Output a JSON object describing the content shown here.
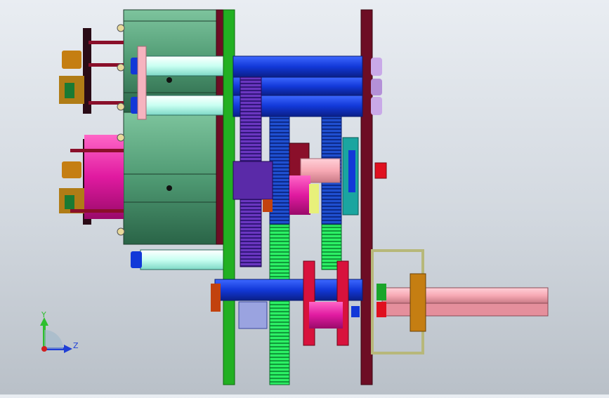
{
  "viewport": {
    "kind": "3D CAD assembly view (gearbox, side projection)"
  },
  "triad": {
    "axis_y": "Y",
    "axis_z": "Z",
    "colors": {
      "y": "#2fbf2f",
      "z": "#1f3fd6",
      "origin": "#d11f1f"
    }
  },
  "palette": {
    "motor_housing": "#4f9a73",
    "plate_green": "#22b022",
    "plate_maroon": "#6d0d24",
    "shaft_blue": "#1238d8",
    "shaft_cyan": "#c9fff2",
    "gear_blue": "#1f4fd0",
    "gear_green": "#1fdc55",
    "gear_purple": "#5a2aa8",
    "gear_magenta": "#e01aa0",
    "sprocket_red": "#d8123c",
    "output_shaft_pink": "#f7a9b4",
    "bracket_khaki": "#b7b87a",
    "bushing_orange": "#c57e12"
  }
}
